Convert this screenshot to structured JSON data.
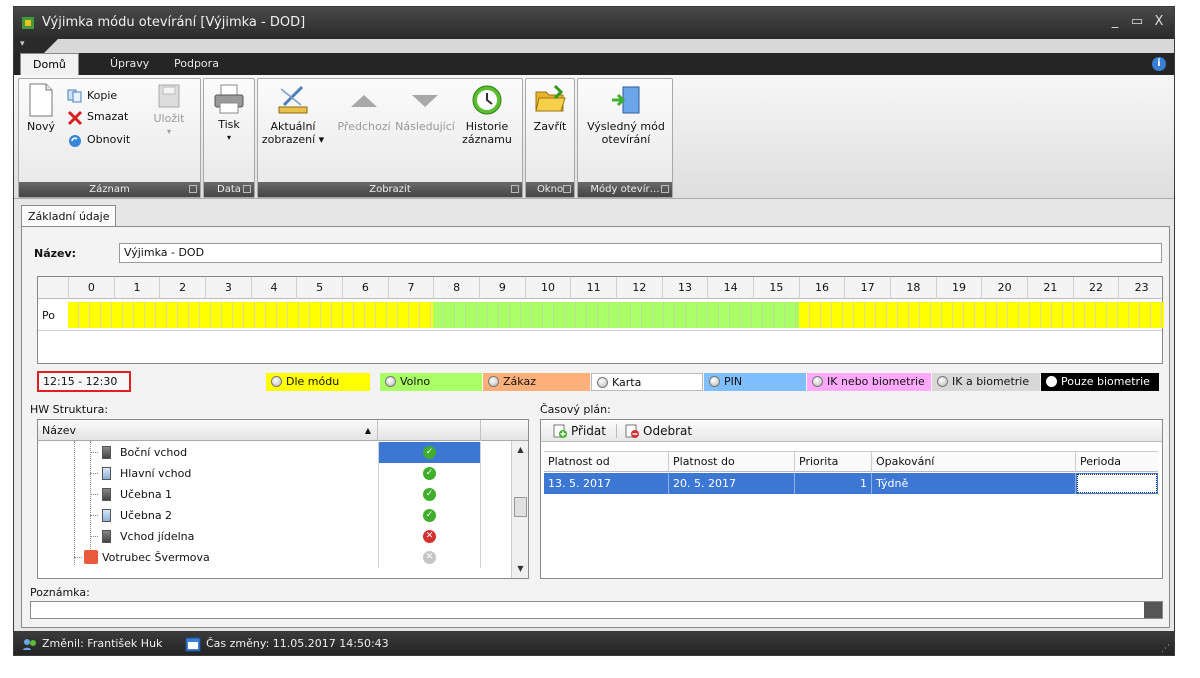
{
  "window": {
    "title": "Výjimka módu otevírání [Výjimka - DOD]",
    "controls": {
      "minimize": "_",
      "maximize": "▭",
      "close": "X"
    }
  },
  "qat": {
    "button": "▾"
  },
  "ribbon": {
    "tabs": [
      {
        "label": "Domů",
        "active": true
      },
      {
        "label": "Úpravy",
        "active": false
      },
      {
        "label": "Podpora",
        "active": false
      }
    ],
    "info_icon": "i",
    "groups": {
      "zaznam": {
        "label": "Záznam",
        "novy": "Nový",
        "kopie": "Kopie",
        "smazat": "Smazat",
        "obnovit": "Obnovit",
        "ulozit": "Uložit"
      },
      "data": {
        "label": "Data",
        "tisk": "Tisk"
      },
      "zobrazit": {
        "label": "Zobrazit",
        "aktualni_1": "Aktuální",
        "aktualni_2": "zobrazení ▾",
        "predchozi": "Předchozí",
        "nasledujici": "Následující",
        "historie_1": "Historie",
        "historie_2": "záznamu"
      },
      "okno": {
        "label": "Okno",
        "zavrit": "Zavřít"
      },
      "mody": {
        "label": "Módy otevír…",
        "vysledny_1": "Výsledný mód",
        "vysledny_2": "otevírání"
      }
    }
  },
  "content_tab": "Základní údaje",
  "form": {
    "name_label": "Název:",
    "name_value": "Výjimka - DOD",
    "hours": [
      "0",
      "1",
      "2",
      "3",
      "4",
      "5",
      "6",
      "7",
      "8",
      "9",
      "10",
      "11",
      "12",
      "13",
      "14",
      "15",
      "16",
      "17",
      "18",
      "19",
      "20",
      "21",
      "22",
      "23"
    ],
    "day_label": "Po",
    "selected_time": "12:15 - 12:30"
  },
  "legend": [
    {
      "label": "Dle módu",
      "color": "#ffff00"
    },
    {
      "label": "Volno",
      "color": "#aaff66"
    },
    {
      "label": "Zákaz",
      "color": "#ffb07a"
    },
    {
      "label": "Karta",
      "color": "#ffffff"
    },
    {
      "label": "PIN",
      "color": "#80bfff"
    },
    {
      "label": "IK nebo biometrie",
      "color": "#ffaaff"
    },
    {
      "label": "IK a biometrie",
      "color": "#d8d8d8"
    },
    {
      "label": "Pouze biometrie",
      "color": "#000000"
    }
  ],
  "timeline_colors": {
    "yellow": "#ffff00",
    "green": "#aaff66"
  },
  "hw": {
    "label": "HW Struktura:",
    "column_name": "Název",
    "sort_indicator": "▲",
    "rows": [
      {
        "name": "Boční vchod",
        "status": "ok",
        "icon": "ok-icon",
        "symbol": "✓"
      },
      {
        "name": "Hlavní vchod",
        "status": "ok",
        "icon": "ok-icon",
        "symbol": "✓"
      },
      {
        "name": "Učebna 1",
        "status": "ok",
        "icon": "ok-icon",
        "symbol": "✓"
      },
      {
        "name": "Učebna 2",
        "status": "ok",
        "icon": "ok-icon",
        "symbol": "✓"
      },
      {
        "name": "Vchod jídelna",
        "status": "err",
        "icon": "error-icon",
        "symbol": "✕"
      },
      {
        "name": "Votrubec Švermova",
        "status": "grey",
        "icon": "disabled-icon",
        "symbol": "✕"
      }
    ]
  },
  "schedule": {
    "label": "Časový plán:",
    "add": "Přidat",
    "remove": "Odebrat",
    "columns": [
      "Platnost od",
      "Platnost do",
      "Priorita",
      "Opakování",
      "Perioda"
    ],
    "rows": [
      {
        "od": "13. 5. 2017",
        "do": "20. 5. 2017",
        "priorita": "1",
        "opakovani": "Týdně",
        "perioda": ""
      }
    ]
  },
  "note": {
    "label": "Poznámka:",
    "value": ""
  },
  "status": {
    "changed_by": "Změnil: František Huk",
    "changed_at": "Čas změny: 11.05.2017 14:50:43"
  }
}
